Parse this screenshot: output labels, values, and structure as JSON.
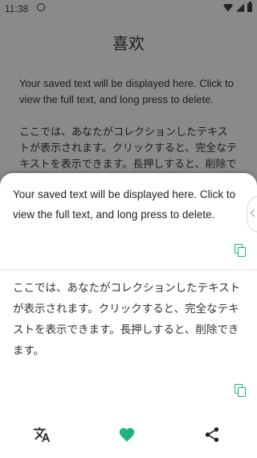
{
  "status_bar": {
    "time": "11:38"
  },
  "background": {
    "title": "喜欢",
    "items": [
      "Your saved text will be displayed here. Click to view the full text, and long press to delete.",
      "ここでは、あなたがコレクションしたテキストが表示されます。クリックすると、完全なテキストを表示できます。長押しすると、削除できます。"
    ]
  },
  "sheet": {
    "cards": [
      {
        "text": "Your saved text will be displayed here. Click to view the full text, and long press to delete."
      },
      {
        "text": "ここでは、あなたがコレクションしたテキストが表示されます。クリックすると、完全なテキストを表示できます。長押しすると、削除できます。"
      }
    ]
  },
  "bottom_nav": {
    "items": [
      {
        "icon": "translate-icon"
      },
      {
        "icon": "heart-icon"
      },
      {
        "icon": "share-icon"
      }
    ],
    "accent_color": "#1db480"
  }
}
